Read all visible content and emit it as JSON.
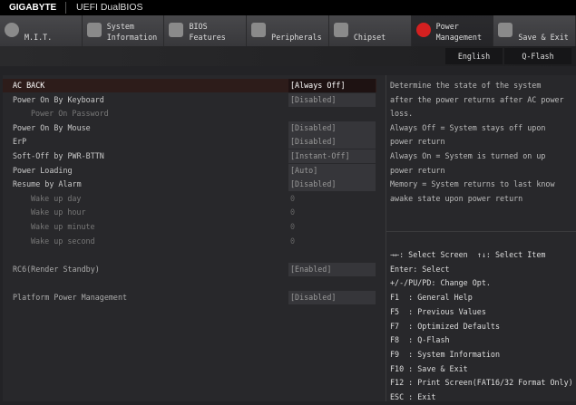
{
  "header": {
    "brand": "GIGABYTE",
    "product": "UEFI DualBIOS"
  },
  "tabs": [
    {
      "l1": "",
      "l2": "M.I.T.",
      "icon": "disc-icon"
    },
    {
      "l1": "System",
      "l2": "Information",
      "icon": "gear-icon"
    },
    {
      "l1": "BIOS",
      "l2": "Features",
      "icon": "bios-chip-icon"
    },
    {
      "l1": "",
      "l2": "Peripherals",
      "icon": "peripherals-icon"
    },
    {
      "l1": "",
      "l2": "Chipset",
      "icon": "chipset-icon"
    },
    {
      "l1": "Power",
      "l2": "Management",
      "icon": "power-bolt-icon",
      "active": true
    },
    {
      "l1": "",
      "l2": "Save & Exit",
      "icon": "exit-door-icon"
    }
  ],
  "toolbar": {
    "english": "English",
    "qflash": "Q-Flash"
  },
  "settings": [
    {
      "label": "AC BACK",
      "value": "[Always Off]",
      "selected": true
    },
    {
      "label": "Power On By Keyboard",
      "value": "[Disabled]"
    },
    {
      "label": "Power On Password",
      "value": "",
      "sub": true
    },
    {
      "label": "Power On By Mouse",
      "value": "[Disabled]"
    },
    {
      "label": "ErP",
      "value": "[Disabled]"
    },
    {
      "label": "Soft-Off by PWR-BTTN",
      "value": "[Instant-Off]"
    },
    {
      "label": "Power Loading",
      "value": "[Auto]"
    },
    {
      "label": "Resume by Alarm",
      "value": "[Disabled]"
    },
    {
      "label": "Wake up day",
      "value": "0",
      "sub": true
    },
    {
      "label": "Wake up hour",
      "value": "0",
      "sub": true
    },
    {
      "label": "Wake up minute",
      "value": "0",
      "sub": true
    },
    {
      "label": "Wake up second",
      "value": "0",
      "sub": true
    },
    {
      "label": "RC6(Render Standby)",
      "value": "[Enabled]",
      "gray": true,
      "row": 13
    },
    {
      "label": "Platform Power Management",
      "value": "[Disabled]",
      "gray": true,
      "row": 15
    }
  ],
  "help": [
    "Determine the state of  the system",
    "after the power returns after AC power",
    "loss.",
    "Always Off = System stays off upon",
    "power return",
    "Always On = System is turned on up",
    "power return",
    "Memory = System returns to last know",
    "awake state upon power return"
  ],
  "keys": [
    "→←: Select Screen  ↑↓: Select Item",
    "Enter: Select",
    "+/-/PU/PD: Change Opt.",
    "F1  : General Help",
    "F5  : Previous Values",
    "F7  : Optimized Defaults",
    "F8  : Q-Flash",
    "F9  : System Information",
    "F10 : Save & Exit",
    "F12 : Print Screen(FAT16/32 Format Only)",
    "ESC : Exit"
  ]
}
